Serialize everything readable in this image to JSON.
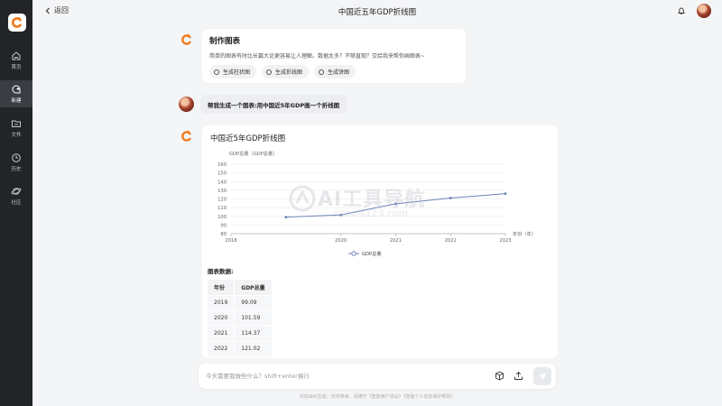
{
  "sidebar": {
    "items": [
      {
        "label": "首页",
        "icon": "home-icon"
      },
      {
        "label": "新建",
        "icon": "new-chat-icon"
      },
      {
        "label": "文件",
        "icon": "folder-icon"
      },
      {
        "label": "历史",
        "icon": "clock-icon"
      },
      {
        "label": "社区",
        "icon": "planet-icon"
      }
    ]
  },
  "header": {
    "back_label": "返回",
    "title": "中国近五年GDP折线图"
  },
  "intro_card": {
    "title": "制作图表",
    "description": "简单的图表有时比长篇大论更容易让人理解。数据太多？不够直观？交给我来帮你画图表~",
    "chips": [
      "生成柱状图",
      "生成折线图",
      "生成饼图"
    ]
  },
  "user_message": "帮我生成一个图表:用中国近5年GDP画一个折线图",
  "chart_card": {
    "title": "中国近5年GDP折线图",
    "table_title": "图表数据:",
    "table_headers": [
      "年份",
      "GDP总量"
    ],
    "table_rows": [
      [
        "2019",
        "99.09"
      ],
      [
        "2020",
        "101.59"
      ],
      [
        "2021",
        "114.37"
      ],
      [
        "2022",
        "121.02"
      ]
    ]
  },
  "chart_data": {
    "type": "line",
    "title": "中国近5年GDP折线图",
    "ylabel": "GDP总量（GDP总量）",
    "xlabel": "年份（年）",
    "categories": [
      "2018",
      "2019",
      "2020",
      "2021",
      "2022",
      "2023"
    ],
    "series": [
      {
        "name": "GDP总量",
        "values": [
          null,
          99.09,
          101.59,
          114.37,
          121.02,
          126.06
        ]
      }
    ],
    "x_ticks": [
      "2018",
      "2020",
      "2021",
      "2022",
      "2023"
    ],
    "y_ticks": [
      80,
      90,
      100,
      110,
      120,
      130,
      140,
      150,
      160
    ],
    "ylim": [
      80,
      160
    ],
    "grid": true,
    "legend": "bottom-center",
    "line_color": "#6f82b8"
  },
  "watermark": {
    "line1": "AI工具导航",
    "line2": "aitools123.com"
  },
  "input": {
    "placeholder": "今天需要我做些什么？shift+enter换行"
  },
  "footer": "内容由AI生成，仅供参考。请遵守《智能用户协议》《智能个人信息保护规则》",
  "colors": {
    "sidebar_bg": "#222428",
    "accent_orange": "#f07a1e",
    "line": "#6f82b8"
  }
}
